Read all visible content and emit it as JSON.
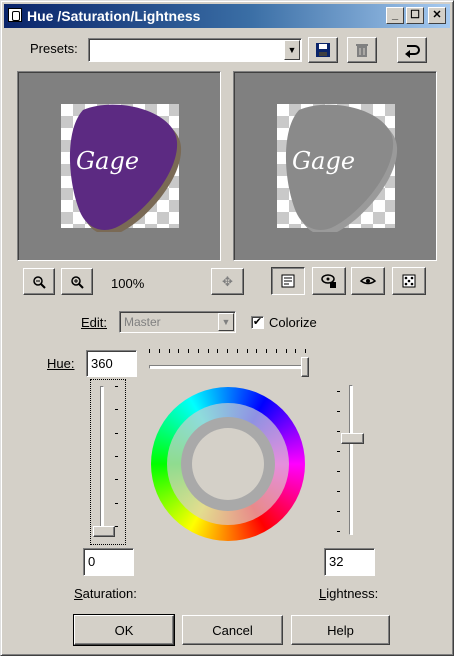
{
  "window": {
    "title": "Hue /Saturation/Lightness",
    "controls": {
      "minimize": "_",
      "maximize": "☐",
      "close": "✕"
    }
  },
  "presets": {
    "label": "Presets:",
    "value": "",
    "icons": [
      "save-preset-icon",
      "delete-preset-icon",
      "reset-icon"
    ]
  },
  "preview": {
    "before_label": "Gage",
    "after_label": "Gage",
    "before_color": "#5c2a82",
    "after_color": "#8a8a8a"
  },
  "zoom": {
    "zoom_out_icon": "🔍",
    "zoom_in_icon": "🔍",
    "level": "100%",
    "pan_icon": "✥"
  },
  "view_toggles": [
    "proof-toggle-icon",
    "auto-proof-icon",
    "preview-eye-icon",
    "randomize-dice-icon"
  ],
  "edit": {
    "label": "Edit:",
    "value": "Master",
    "colorize_label": "Colorize",
    "colorize_checked": "✔"
  },
  "hue": {
    "label": "Hue:",
    "value": "360",
    "max": 360
  },
  "saturation": {
    "label": "Saturation:",
    "value": "0",
    "fraction": 0
  },
  "lightness": {
    "label": "Lightness:",
    "value": "32",
    "fraction": 0.66
  },
  "buttons": {
    "ok": "OK",
    "cancel": "Cancel",
    "help": "Help"
  },
  "colors": {
    "title_gradient_start": "#0a246a",
    "dialog_face": "#d4d0c8",
    "preview_bg": "#808080"
  }
}
